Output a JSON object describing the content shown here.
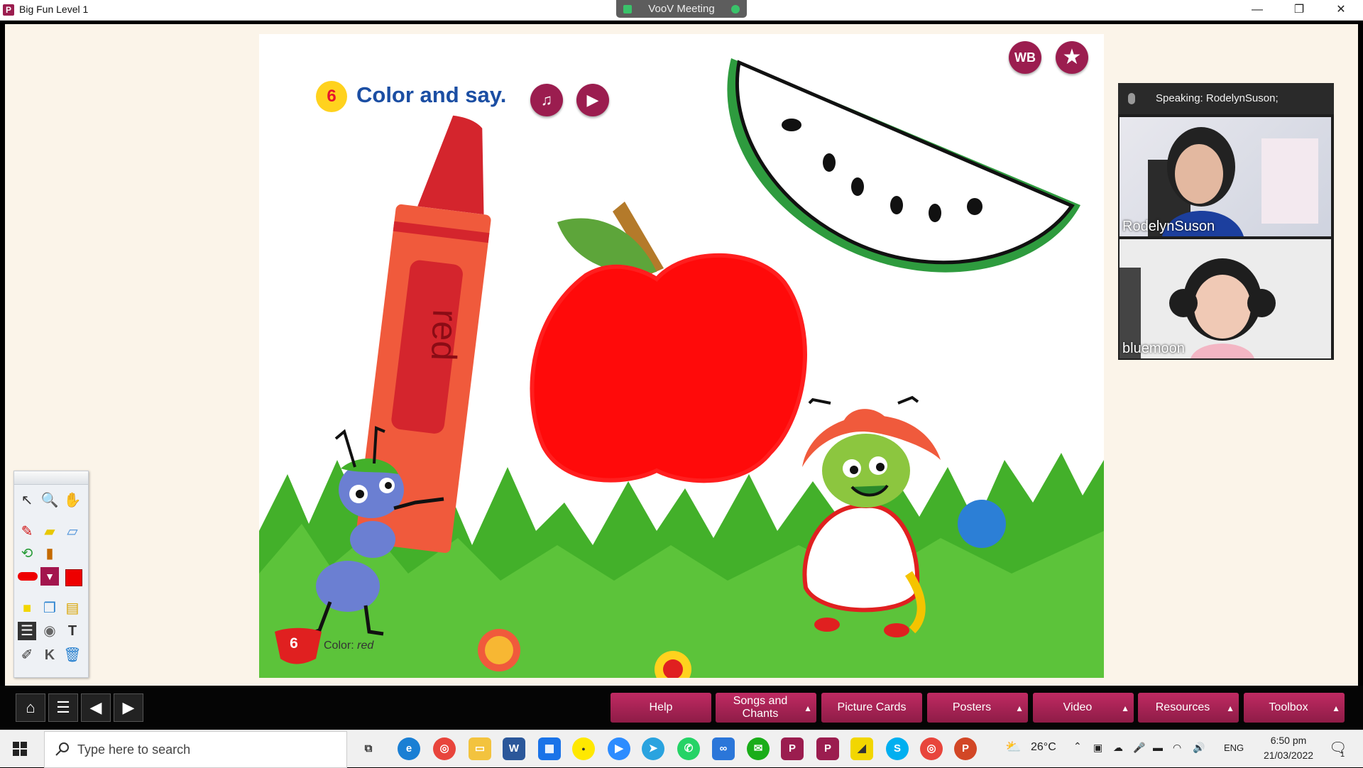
{
  "window": {
    "title": "Big Fun Level 1",
    "meeting_title": "VooV Meeting",
    "minimize": "—",
    "maximize": "❐",
    "close": "✕"
  },
  "slide": {
    "lesson_number": "6",
    "title": "Color and say.",
    "wb_label": "WB",
    "star_icon": "★",
    "music_icon": "♫",
    "play_icon": "▶",
    "crayon_word": "red",
    "footer_number": "6",
    "footer_caption_prefix": "Color: ",
    "footer_caption_word": "red"
  },
  "meeting": {
    "speaking": "Speaking: RodelynSuson;",
    "participants": [
      {
        "name": "RodelynSuson"
      },
      {
        "name": "bluemoon"
      }
    ]
  },
  "nav": {
    "home": "⌂",
    "menu": "☰",
    "prev": "◀",
    "next": "▶",
    "buttons": [
      {
        "label": "Help",
        "has_menu": false
      },
      {
        "label": "Songs and Chants",
        "has_menu": true
      },
      {
        "label": "Picture Cards",
        "has_menu": false
      },
      {
        "label": "Posters",
        "has_menu": true
      },
      {
        "label": "Video",
        "has_menu": true
      },
      {
        "label": "Resources",
        "has_menu": true
      },
      {
        "label": "Toolbox",
        "has_menu": true
      }
    ],
    "menu_arrow": "▲"
  },
  "taskbar": {
    "search_placeholder": "Type here to search",
    "weather": "26°C",
    "language": "ENG",
    "time": "6:50 pm",
    "date": "21/03/2022",
    "notification_count": "1"
  },
  "colors": {
    "brand": "#9b1d4f",
    "apple_red": "#ff0000",
    "title_blue": "#1b4ea3",
    "grass": "#43b02a"
  }
}
